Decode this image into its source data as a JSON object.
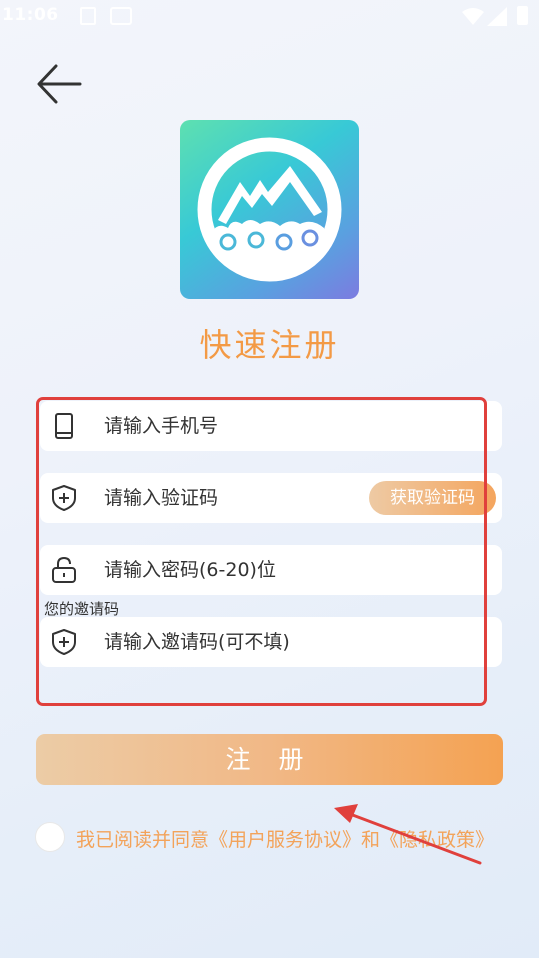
{
  "status_bar": {
    "time": "11:06"
  },
  "page_title": "快速注册",
  "fields": {
    "phone_placeholder": "请输入手机号",
    "code_placeholder": "请输入验证码",
    "get_code_label": "获取验证码",
    "password_placeholder": "请输入密码(6-20)位",
    "invite_caption": "您的邀请码",
    "invite_placeholder": "请输入邀请码(可不填)"
  },
  "register_label": "注 册",
  "agreement": {
    "prefix": "我已阅读并同意",
    "user_agreement": "《用户服务协议》",
    "conjunction": "和",
    "privacy_policy": "《隐私政策》"
  },
  "colors": {
    "accent": "#f39a45",
    "annotation": "#e0403c"
  }
}
